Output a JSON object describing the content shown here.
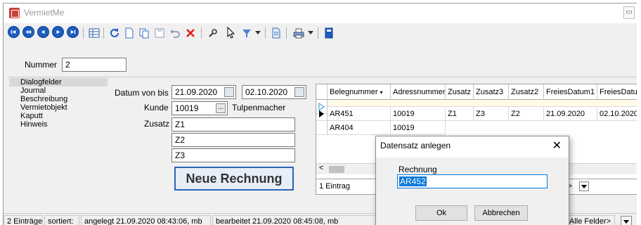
{
  "window": {
    "title": "VermietMe"
  },
  "toolbar": {
    "nav_buttons": [
      "first-record",
      "previous-page",
      "previous-record",
      "next-record",
      "last-record"
    ],
    "icons": [
      "table-icon",
      "refresh-icon",
      "new-icon",
      "copy-icon",
      "save-icon",
      "undo-icon",
      "delete-icon",
      "search-icon",
      "mouse-pointer-icon",
      "filter-icon",
      "filter-dropdown-icon",
      "document-icon",
      "print-icon",
      "print-dropdown-icon",
      "settings-icon"
    ]
  },
  "header": {
    "nummer_label": "Nummer",
    "nummer_value": "2"
  },
  "nav": {
    "items": [
      "Dialogfelder",
      "Journal",
      "Beschreibung",
      "Vermietobjekt",
      "Kaputt",
      "Hinweis"
    ]
  },
  "form": {
    "datum_label": "Datum von bis",
    "datum_von": "21.09.2020",
    "datum_bis": "02.10.2020",
    "kunde_label": "Kunde",
    "kunde_value": "10019",
    "kunde_name": "Tulpenmacher",
    "zusatz_label": "Zusatz",
    "zusatz": [
      "Z1",
      "Z2",
      "Z3"
    ],
    "ellipsis": "...",
    "action_button": "Neue Rechnung"
  },
  "grid": {
    "columns": [
      "Belegnummer",
      "Adressnummer",
      "Zusatz",
      "Zusatz3",
      "Zusatz2",
      "FreiesDatum1",
      "FreiesDatum"
    ],
    "rows": [
      [
        "AR451",
        "10019",
        "Z1",
        "Z3",
        "Z2",
        "21.09.2020",
        "02.10.2020"
      ],
      [
        "AR404",
        "10019",
        "",
        "",
        "",
        "",
        ""
      ]
    ],
    "footer_text": "1 Eintrag",
    "footer_right": "r>"
  },
  "status": {
    "eintraege": "2 Einträge",
    "sortiert": "sortiert:",
    "angelegt": "angelegt 21.09.2020 08:43:06, mb",
    "bearbeitet": "bearbeitet 21.09.2020 08:45:08, mb",
    "alle_felder": "Alle Felder>"
  },
  "dialog": {
    "title": "Datensatz anlegen",
    "close": "✕",
    "field_label": "Rechnung",
    "field_value": "AR452",
    "ok": "Ok",
    "cancel": "Abbrechen"
  },
  "colors": {
    "accent": "#2a64b8",
    "selection": "#1f5fc6"
  }
}
